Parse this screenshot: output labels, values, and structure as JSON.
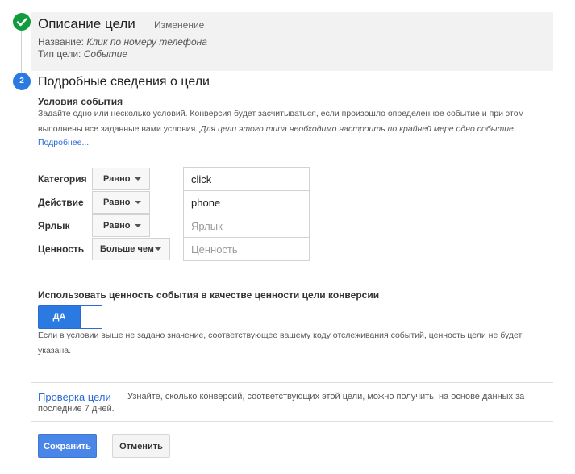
{
  "step1": {
    "title": "Описание цели",
    "edit_link": "Изменение",
    "name_label": "Название:",
    "name_value": "Клик по номеру телефона",
    "type_label": "Тип цели:",
    "type_value": "Событие",
    "completed_color": "#109b3d"
  },
  "step2": {
    "number": "2",
    "title": "Подробные сведения о цели",
    "accent_color": "#2a7ae2",
    "conditions_heading": "Условия события",
    "description": "Задайте одно или несколько условий. Конверсия будет засчитываться, если произошло определенное событие и при этом выполнены все заданные вами условия.",
    "description_italic": "Для цели этого типа необходимо настроить по крайней мере одно событие.",
    "more_link": "Подробнее...",
    "conditions": [
      {
        "label": "Категория",
        "operator": "Равно",
        "value": "click",
        "placeholder": ""
      },
      {
        "label": "Действие",
        "operator": "Равно",
        "value": "phone",
        "placeholder": ""
      },
      {
        "label": "Ярлык",
        "operator": "Равно",
        "value": "",
        "placeholder": "Ярлык"
      },
      {
        "label": "Ценность",
        "operator": "Больше чем",
        "value": "",
        "placeholder": "Ценность"
      }
    ],
    "use_value_heading": "Использовать ценность события в качестве ценности цели конверсии",
    "toggle_label": "ДА",
    "toggle_on": true,
    "use_value_note": "Если в условии выше не задано значение, соответствующее вашему коду отслеживания событий, ценность цели не будет указана."
  },
  "verify": {
    "title": "Проверка цели",
    "text": "Узнайте, сколько конверсий, соответствующих этой цели, можно получить, на основе данных за последние 7 дней."
  },
  "actions": {
    "save_label": "Сохранить",
    "cancel_label": "Отменить"
  }
}
